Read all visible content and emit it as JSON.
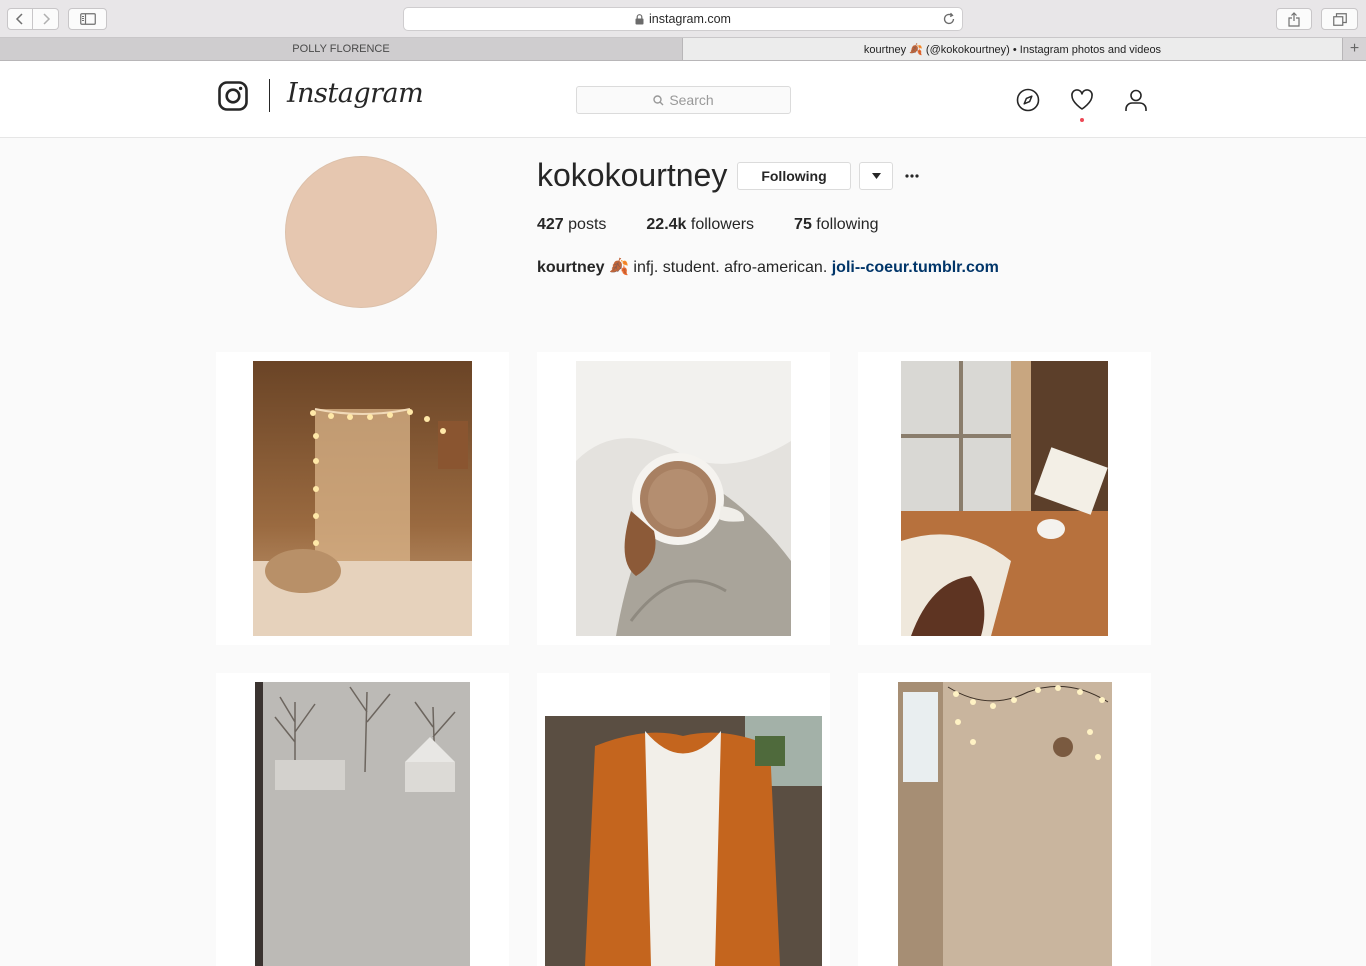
{
  "browser": {
    "url": "instagram.com",
    "tabs": [
      {
        "label": "POLLY FLORENCE"
      },
      {
        "label": "kourtney 🍂 (@kokokourtney) • Instagram photos and videos"
      }
    ],
    "new_tab_label": "+"
  },
  "nav": {
    "wordmark": "Instagram",
    "search_placeholder": "Search"
  },
  "profile": {
    "username": "kokokourtney",
    "follow_button": "Following",
    "stats": {
      "posts_count": "427",
      "posts_label": "posts",
      "followers_count": "22.4k",
      "followers_label": "followers",
      "following_count": "75",
      "following_label": "following"
    },
    "bio": {
      "name": "kourtney",
      "emoji": "🍂",
      "text": "infj. student. afro-american.",
      "link": "joli--coeur.tumblr.com"
    },
    "avatar_color": "#e6c7b0"
  },
  "colors": {
    "link": "#003569",
    "notification": "#ed4956"
  },
  "icons": {
    "explore": "compass-icon",
    "activity": "heart-icon",
    "profile": "person-icon",
    "search": "search-icon"
  }
}
